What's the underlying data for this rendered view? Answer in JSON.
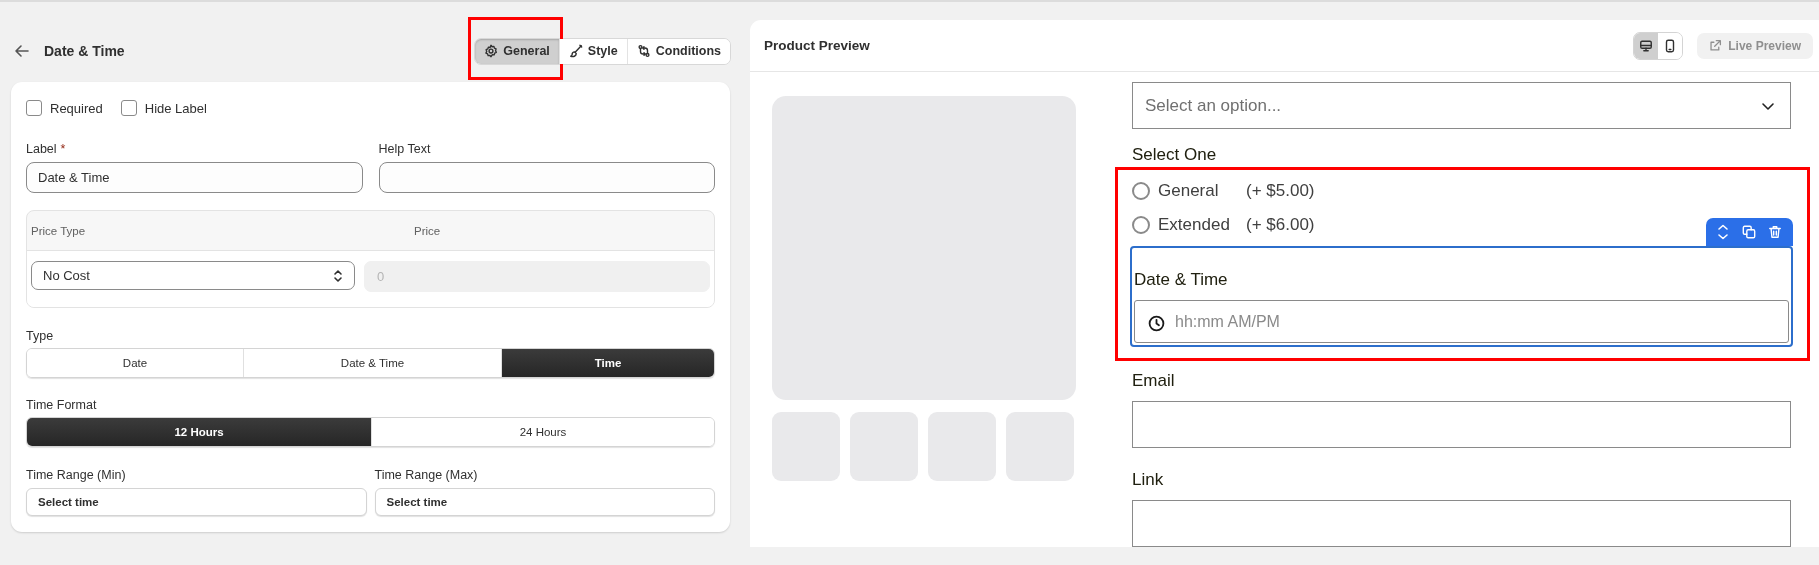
{
  "editor": {
    "title": "Date & Time",
    "tabs": [
      {
        "kind": "gear",
        "label": "General",
        "selected": true,
        "highlighted": true
      },
      {
        "kind": "brush",
        "label": "Style",
        "selected": false,
        "highlighted": false
      },
      {
        "kind": "swap",
        "label": "Conditions",
        "selected": false,
        "highlighted": false
      }
    ],
    "checkboxes": [
      {
        "label": "Required",
        "checked": false
      },
      {
        "label": "Hide Label",
        "checked": false
      }
    ],
    "label_field": {
      "label": "Label",
      "required_mark": "*",
      "value": "Date & Time"
    },
    "help_field": {
      "label": "Help Text"
    },
    "pricing": {
      "columns": [
        "Price Type",
        "Price"
      ],
      "price_type": "No Cost",
      "price": {
        "value": "0",
        "disabled": true
      }
    },
    "type": {
      "label": "Type",
      "options": [
        {
          "label": "Date",
          "selected": false
        },
        {
          "label": "Date & Time",
          "selected": false
        },
        {
          "label": "Time",
          "selected": true
        }
      ]
    },
    "time_format": {
      "label": "Time Format",
      "options": [
        {
          "label": "12 Hours",
          "selected": true
        },
        {
          "label": "24 Hours",
          "selected": false
        }
      ]
    },
    "range_fields": [
      {
        "label": "Time Range (Min)",
        "value": "Select time"
      },
      {
        "label": "Time Range (Max)",
        "value": "Select time"
      }
    ]
  },
  "preview": {
    "title": "Product Preview",
    "devices": [
      {
        "kind": "desktop",
        "selected": true
      },
      {
        "kind": "mobile",
        "selected": false
      }
    ],
    "live_preview": {
      "label": "Live Preview",
      "disabled": true
    },
    "form": {
      "select_placeholder": "Select an option...",
      "radio_group": {
        "label": "Select One",
        "highlighted": true,
        "options": [
          {
            "label": "General",
            "price": "(+ $5.00)",
            "selected": false
          },
          {
            "label": "Extended",
            "price": "(+ $6.00)",
            "selected": false
          }
        ]
      },
      "selected_field": {
        "label": "Date & Time",
        "placeholder": "hh:mm AM/PM"
      },
      "fields": [
        {
          "label": "Email"
        },
        {
          "label": "Link"
        }
      ]
    }
  }
}
